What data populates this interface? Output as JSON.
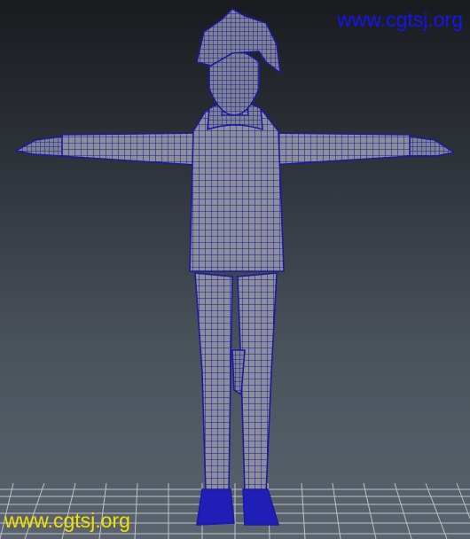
{
  "watermarks": {
    "top": "www.cgtsj.org",
    "bottom": "www.cgtsj.org"
  },
  "colors": {
    "top_watermark": "#1515f0",
    "bottom_watermark": "#f2e000",
    "wireframe": "#1b1aa0",
    "mesh_fill": "#8a8d98",
    "grid": "#cfd3d8"
  },
  "viewport": {
    "content": "t-pose-character-wireframe",
    "display_mode": "wireframe-on-shaded",
    "ground_grid": true
  }
}
